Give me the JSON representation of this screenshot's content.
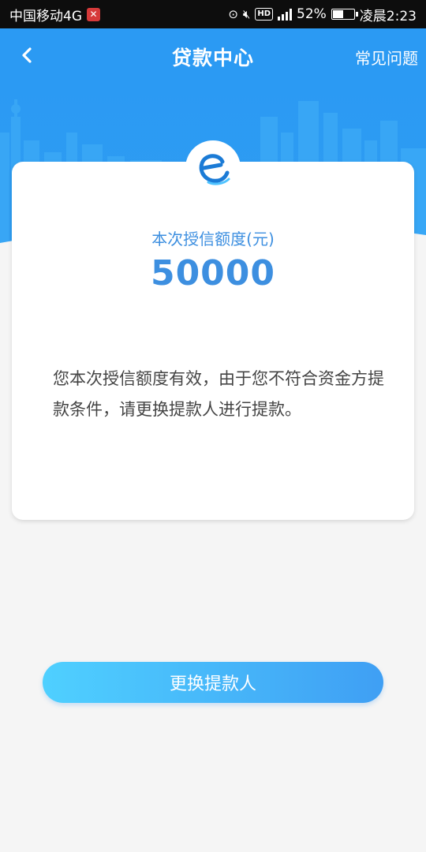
{
  "status_bar": {
    "carrier": "中国移动4G",
    "network": "4G",
    "battery_percent": "52%",
    "battery_level": 0.52,
    "time": "凌晨2:23",
    "hd_label": "HD"
  },
  "header": {
    "title": "贷款中心",
    "faq_label": "常见问题",
    "back_icon": "chevron-left-icon"
  },
  "card": {
    "credit_label": "本次授信额度(元)",
    "credit_value": "50000",
    "notice": "您本次授信额度有效，由于您不符合资金方提款条件，请更换提款人进行提款。"
  },
  "actions": {
    "change_borrower_label": "更换提款人"
  },
  "colors": {
    "primary_blue": "#2b9af3",
    "amount_blue": "#3d8fe0",
    "button_start": "#4fd0ff",
    "button_end": "#3f9ff4"
  }
}
